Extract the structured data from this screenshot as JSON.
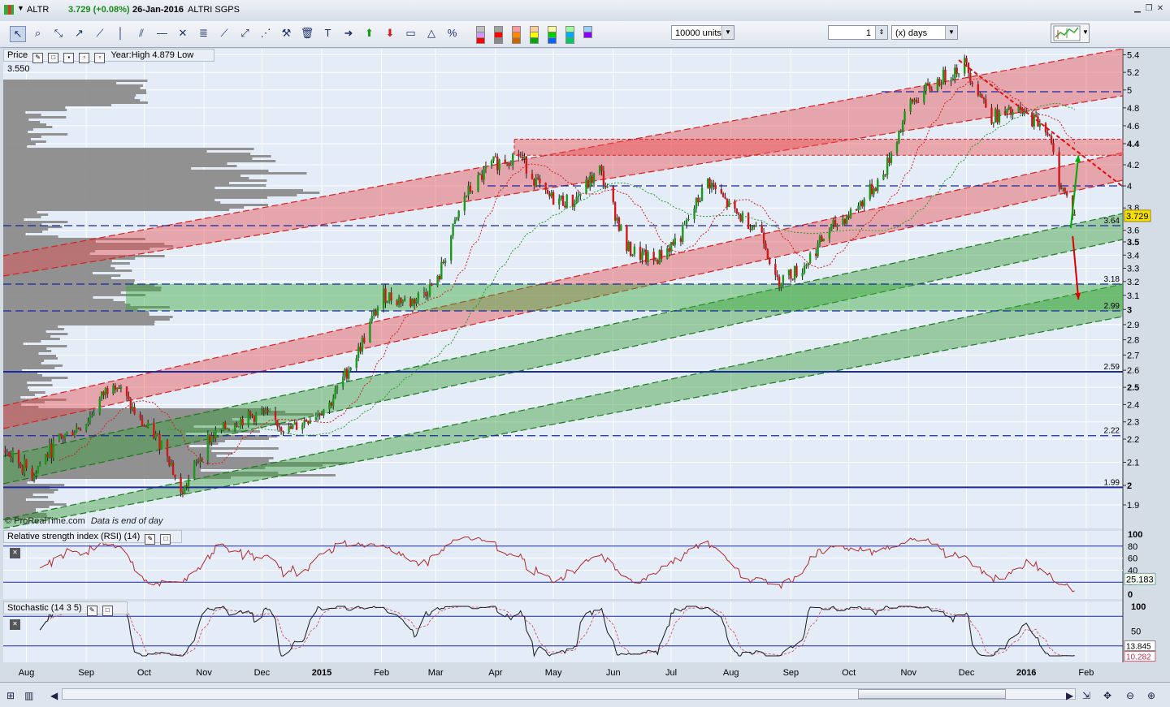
{
  "window": {
    "symbol": "ALTR",
    "price_text": "3.729 (+0.08%)",
    "date": "26-Jan-2016",
    "name": "ALTRI SGPS"
  },
  "toolbar": {
    "units_select": "10000 units",
    "period_value": "1",
    "period_unit": "(x) days",
    "tools": [
      "pointer-icon",
      "zoom-icon",
      "trendline-icon",
      "ray-icon",
      "segment-icon",
      "vertical-line-icon",
      "channel-icon",
      "horizontal-line-icon",
      "cross-icon",
      "fibonacci-icon",
      "ruler-icon",
      "fan-icon",
      "gann-icon",
      "hammer-icon",
      "trash-icon",
      "text-icon",
      "arrow-right-icon",
      "arrow-up-icon",
      "arrow-down-icon",
      "rectangle-icon",
      "triangle-icon",
      "percent-icon"
    ],
    "palette": [
      "#c0c0c0",
      "#a0a0a0",
      "#ff9999",
      "#ffcc99",
      "#ffff99",
      "#99ff99",
      "#99ccff",
      "#cc99ff",
      "#ff0000",
      "#ff8800",
      "#ffff00",
      "#00cc00",
      "#00aaff",
      "#8800ff",
      "#ff0000",
      "#888888",
      "#cc6600",
      "#00aa00",
      "#0066ff",
      "#00cc66"
    ]
  },
  "price_panel": {
    "label": "Price",
    "yearly_info": "Year:High 4.879 Low 3.550",
    "copyright": "© ProRealTime.com",
    "data_note": "Data is end of day",
    "current_value": "3.729"
  },
  "rsi_panel": {
    "label": "Relative strength index (RSI) (14)",
    "current_value": "25.183",
    "ticks": [
      "100",
      "80",
      "60",
      "40",
      "20",
      "0"
    ]
  },
  "stoch_panel": {
    "label": "Stochastic (14 3 5)",
    "value_k": "13.845",
    "value_d": "10.282",
    "ticks": [
      "100",
      "50"
    ]
  },
  "x_axis": {
    "months": [
      "Aug",
      "Sep",
      "Oct",
      "Nov",
      "Dec",
      "2015",
      "Feb",
      "Mar",
      "Apr",
      "May",
      "Jun",
      "Jul",
      "Aug",
      "Sep",
      "Oct",
      "Nov",
      "Dec",
      "2016",
      "Feb"
    ]
  },
  "chart_data": {
    "type": "candlestick",
    "title": "ALTR ALTRI SGPS",
    "x_range": [
      "2014-07-20",
      "2016-02-20"
    ],
    "ylim": [
      1.8,
      5.45
    ],
    "y_ticks": [
      "1.9",
      "2",
      "2.1",
      "2.2",
      "2.3",
      "2.4",
      "2.5",
      "2.6",
      "2.7",
      "2.8",
      "2.9",
      "3",
      "3.1",
      "3.2",
      "3.3",
      "3.4",
      "3.5",
      "3.6",
      "3.8",
      "4",
      "4.2",
      "4.4",
      "4.6",
      "4.8",
      "5",
      "5.2",
      "5.4"
    ],
    "bold_ticks": [
      "2",
      "2.5",
      "3",
      "3.5",
      "4.4"
    ],
    "horizontal_levels": [
      {
        "value": 2.59,
        "label": "2.59",
        "style": "solid"
      },
      {
        "value": 1.99,
        "label": "1.99",
        "style": "solid"
      },
      {
        "value": 2.22,
        "label": "2.22",
        "style": "dashed"
      },
      {
        "value": 2.99,
        "label": "2.99",
        "style": "dashed"
      },
      {
        "value": 3.18,
        "label": "3.18",
        "style": "dashed"
      },
      {
        "value": 3.64,
        "label": "3.64",
        "style": "dashed"
      },
      {
        "value": 4.0,
        "label": "",
        "style": "dashed"
      },
      {
        "value": 4.98,
        "label": "",
        "style": "dashed"
      }
    ],
    "resistance_zone": [
      4.29,
      4.45
    ],
    "support_zone": [
      2.99,
      3.18
    ],
    "close_series": {
      "dates": [
        "2014-07-21",
        "2014-08-04",
        "2014-08-18",
        "2014-09-01",
        "2014-09-15",
        "2014-09-29",
        "2014-10-13",
        "2014-10-20",
        "2014-11-03",
        "2014-11-17",
        "2014-12-01",
        "2014-12-15",
        "2015-01-05",
        "2015-01-19",
        "2015-02-02",
        "2015-02-16",
        "2015-03-02",
        "2015-03-16",
        "2015-03-30",
        "2015-04-13",
        "2015-04-27",
        "2015-05-11",
        "2015-05-25",
        "2015-06-08",
        "2015-06-22",
        "2015-07-06",
        "2015-07-20",
        "2015-08-03",
        "2015-08-17",
        "2015-08-24",
        "2015-09-07",
        "2015-09-21",
        "2015-10-05",
        "2015-10-19",
        "2015-11-02",
        "2015-11-16",
        "2015-11-30",
        "2015-12-14",
        "2015-12-28",
        "2016-01-11",
        "2016-01-18",
        "2016-01-26"
      ],
      "values": [
        2.15,
        2.05,
        2.2,
        2.3,
        2.55,
        2.3,
        2.15,
        1.95,
        2.2,
        2.3,
        2.35,
        2.25,
        2.4,
        2.7,
        3.1,
        3.05,
        3.2,
        3.9,
        4.2,
        4.3,
        3.9,
        3.85,
        4.15,
        3.45,
        3.35,
        3.55,
        4.05,
        3.75,
        3.6,
        3.2,
        3.3,
        3.6,
        3.8,
        4.1,
        4.85,
        5.1,
        5.3,
        4.7,
        4.75,
        4.6,
        4.05,
        3.729
      ]
    },
    "annotations": [
      {
        "type": "arrow",
        "color": "#00aa00",
        "from": [
          "2016-01-24",
          3.62
        ],
        "to": [
          "2016-01-28",
          4.29
        ]
      },
      {
        "type": "arrow",
        "color": "#dd0000",
        "from": [
          "2016-01-25",
          3.55
        ],
        "to": [
          "2016-01-28",
          3.07
        ]
      }
    ]
  }
}
